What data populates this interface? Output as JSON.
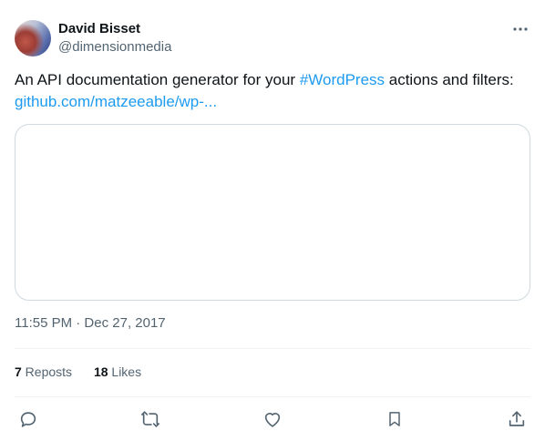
{
  "author": {
    "name": "David Bisset",
    "handle": "@dimensionmedia"
  },
  "tweet": {
    "text_before": "An API documentation generator for your ",
    "hashtag": "#WordPress",
    "text_middle": " actions and filters: ",
    "link": "github.com/matzeeable/wp-..."
  },
  "meta": {
    "timestamp": "11:55 PM · Dec 27, 2017"
  },
  "stats": {
    "reposts_count": "7",
    "reposts_label": " Reposts",
    "likes_count": "18",
    "likes_label": " Likes"
  },
  "icons": {
    "more": "more-horizontal-icon",
    "reply": "reply-icon",
    "repost": "repost-icon",
    "like": "heart-icon",
    "bookmark": "bookmark-icon",
    "share": "share-icon"
  },
  "colors": {
    "link": "#1d9bf0",
    "secondary_text": "#536471",
    "primary_text": "#0f1419",
    "border": "#cfd9de"
  }
}
